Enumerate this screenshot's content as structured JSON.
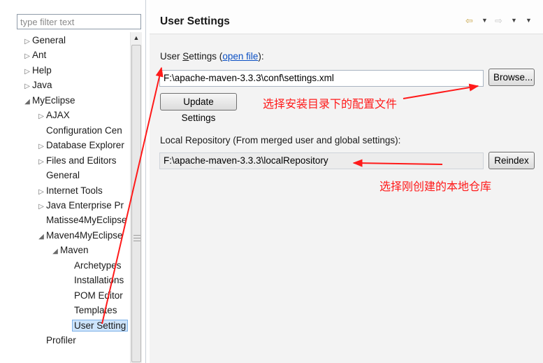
{
  "filter": {
    "placeholder": "type filter text"
  },
  "tree": [
    {
      "label": "General",
      "twisty": "▷",
      "depth": 0
    },
    {
      "label": "Ant",
      "twisty": "▷",
      "depth": 0
    },
    {
      "label": "Help",
      "twisty": "▷",
      "depth": 0
    },
    {
      "label": "Java",
      "twisty": "▷",
      "depth": 0
    },
    {
      "label": "MyEclipse",
      "twisty": "◢",
      "depth": 0
    },
    {
      "label": "AJAX",
      "twisty": "▷",
      "depth": 1
    },
    {
      "label": "Configuration Cen",
      "twisty": "",
      "depth": 1
    },
    {
      "label": "Database Explorer",
      "twisty": "▷",
      "depth": 1
    },
    {
      "label": "Files and Editors",
      "twisty": "▷",
      "depth": 1
    },
    {
      "label": "General",
      "twisty": "",
      "depth": 1
    },
    {
      "label": "Internet Tools",
      "twisty": "▷",
      "depth": 1
    },
    {
      "label": "Java Enterprise Pr",
      "twisty": "▷",
      "depth": 1
    },
    {
      "label": "Matisse4MyEclipse",
      "twisty": "",
      "depth": 1
    },
    {
      "label": "Maven4MyEclipse",
      "twisty": "◢",
      "depth": 1
    },
    {
      "label": "Maven",
      "twisty": "◢",
      "depth": 2
    },
    {
      "label": "Archetypes",
      "twisty": "",
      "depth": 3
    },
    {
      "label": "Installations",
      "twisty": "",
      "depth": 3
    },
    {
      "label": "POM Editor",
      "twisty": "",
      "depth": 3
    },
    {
      "label": "Templates",
      "twisty": "",
      "depth": 3
    },
    {
      "label": "User Setting",
      "twisty": "",
      "depth": 3,
      "selected": true
    },
    {
      "label": "Profiler",
      "twisty": "",
      "depth": 1
    }
  ],
  "header": {
    "title": "User Settings",
    "back_icon": "⇦",
    "forward_icon": "⇨",
    "dropdown_icon": "▼"
  },
  "user_settings": {
    "label_prefix": "User ",
    "label_mnemonic": "S",
    "label_rest": "ettings (",
    "link": "open file",
    "label_suffix": "):",
    "path": "F:\\apache-maven-3.3.3\\conf\\settings.xml",
    "browse": "Browse...",
    "update": "Update Settings"
  },
  "local_repo": {
    "label": "Local Repository (From merged user and global settings):",
    "path": "F:\\apache-maven-3.3.3\\localRepository",
    "reindex": "Reindex"
  },
  "annotations": {
    "settings_note": "选择安装目录下的配置文件",
    "repo_note": "选择刚创建的本地仓库"
  },
  "colors": {
    "annotation": "#ff1a1a",
    "link": "#0a4fc4",
    "selection": "#cde4fb"
  }
}
